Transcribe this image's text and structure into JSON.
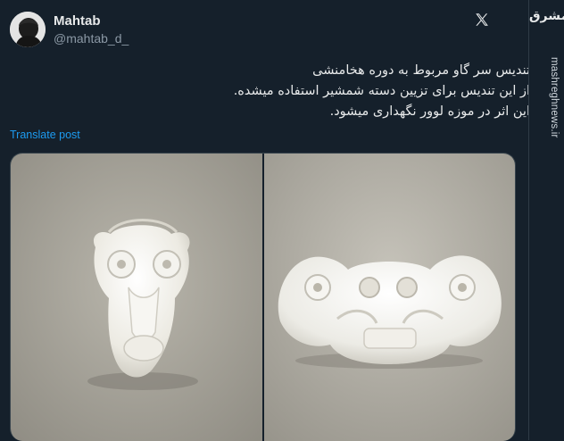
{
  "tweet": {
    "author": {
      "display_name": "Mahtab",
      "handle": "@mahtab_d_",
      "avatar_icon": "profile-silhouette-avatar"
    },
    "text_lines": [
      "تندیس سر گاو مربوط به دوره هخامنشی",
      "از این تندیس برای تزیین دسته شمشیر استفاده میشده.",
      "این اثر در موزه لوور نگهداری میشود."
    ],
    "translate_label": "Translate post",
    "platform_icon": "x-logo-icon",
    "media": {
      "images": [
        {
          "name": "bull-head-front-photo"
        },
        {
          "name": "double-bull-head-side-photo"
        }
      ]
    }
  },
  "watermark": {
    "logo_text": "مشرق",
    "url": "mashreghnews.ir"
  },
  "colors": {
    "background": "#15202b",
    "text": "#e7e9ea",
    "secondary_text": "#8b98a5",
    "link": "#1d9bf0"
  }
}
